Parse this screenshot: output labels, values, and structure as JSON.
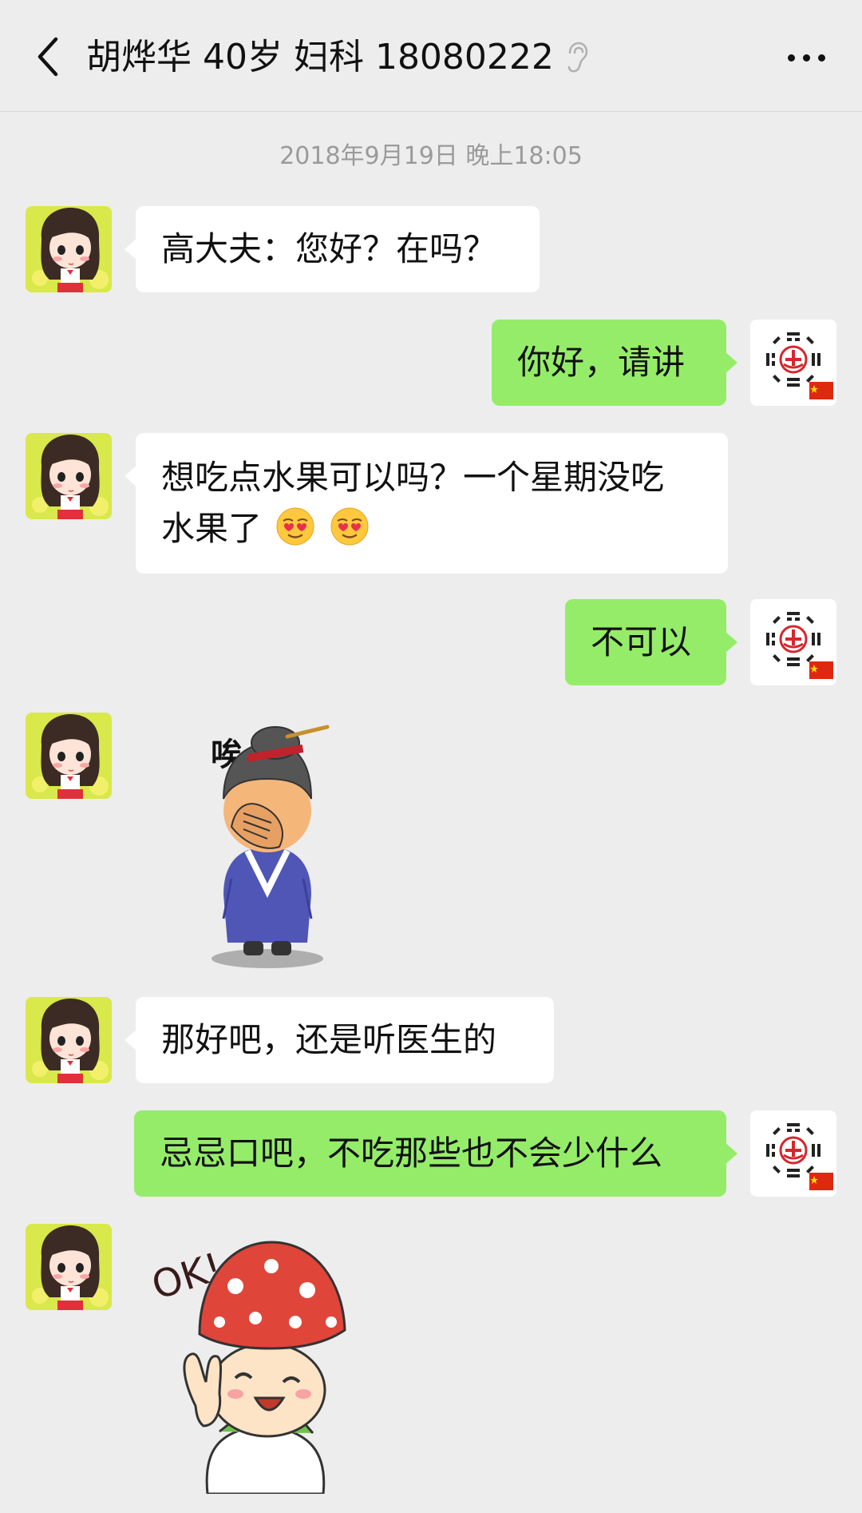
{
  "header": {
    "title": "胡烨华 40岁 妇科 18080222",
    "back_icon": "chevron-left-icon",
    "ear_icon": "ear-icon",
    "more_icon": "more-dots-icon"
  },
  "timestamp": "2018年9月19日 晚上18:05",
  "messages": [
    {
      "side": "left",
      "type": "text",
      "text": "高大夫：您好？在吗？"
    },
    {
      "side": "right",
      "type": "text",
      "text": "你好，请讲"
    },
    {
      "side": "left",
      "type": "text",
      "text_line1": "想吃点水果可以吗？一个星期没吃",
      "text_line2": "水果了",
      "emoji": "smiling-face-with-heart-eyes"
    },
    {
      "side": "right",
      "type": "text",
      "text": "不可以"
    },
    {
      "side": "left",
      "type": "sticker",
      "caption": "唉~"
    },
    {
      "side": "left",
      "type": "text",
      "text": "那好吧，还是听医生的"
    },
    {
      "side": "right",
      "type": "text",
      "text": "忌忌口吧，不吃那些也不会少什么"
    },
    {
      "side": "left",
      "type": "sticker",
      "caption": "OK!"
    }
  ],
  "colors": {
    "background": "#ededed",
    "bubble_left": "#ffffff",
    "bubble_right": "#95ec69",
    "timestamp": "#9a9a9a"
  }
}
